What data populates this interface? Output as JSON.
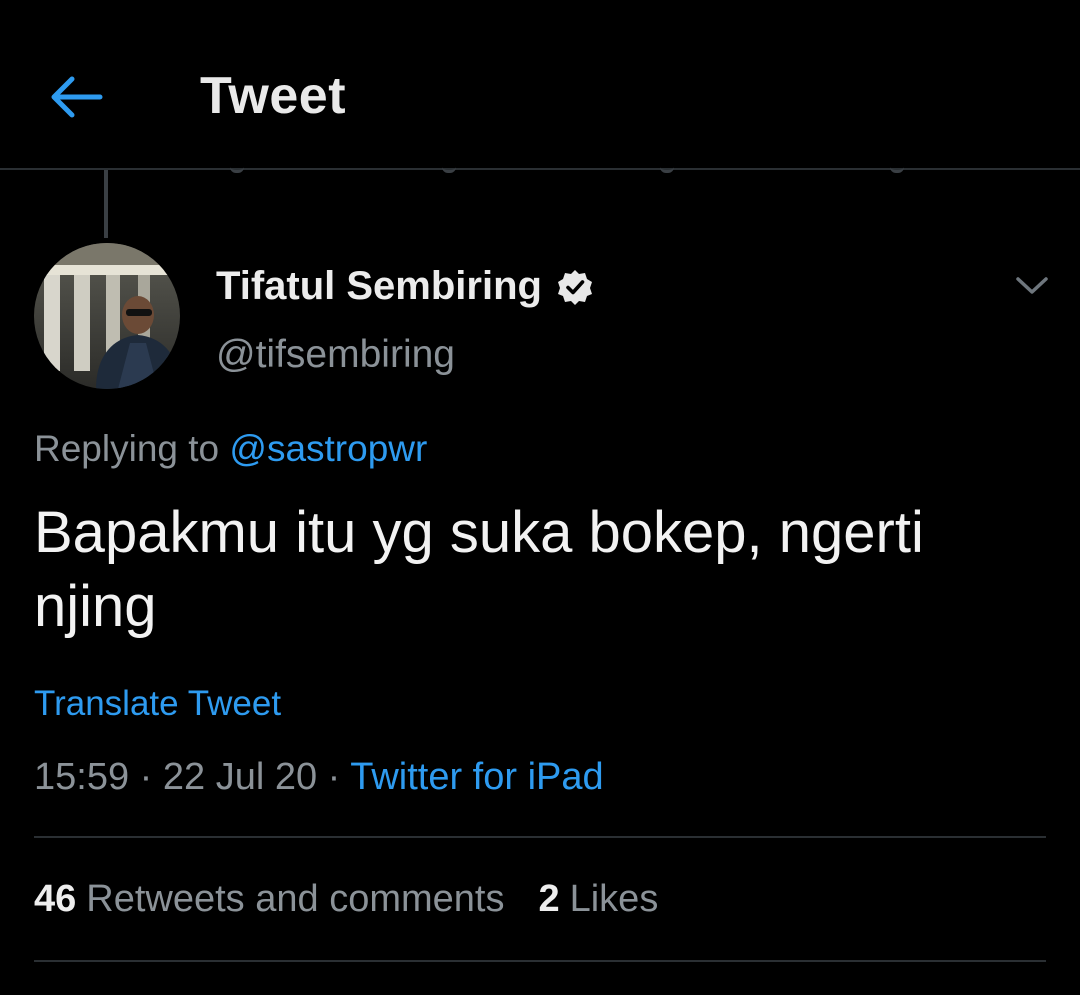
{
  "header": {
    "title": "Tweet",
    "back_icon": "arrow-left-icon",
    "accent_color": "#2e9bf0"
  },
  "tweet": {
    "display_name": "Tifatul Sembiring",
    "verified": true,
    "handle": "@tifsembiring",
    "replying_prefix": "Replying to",
    "replying_to": "@sastropwr",
    "text": "Bapakmu itu yg suka bokep, ngerti njing",
    "translate_label": "Translate Tweet",
    "time": "15:59",
    "separator": "·",
    "date": "22 Jul 20",
    "source": "Twitter for iPad"
  },
  "stats": {
    "retweets_count": "46",
    "retweets_label": "Retweets and comments",
    "likes_count": "2",
    "likes_label": "Likes"
  }
}
